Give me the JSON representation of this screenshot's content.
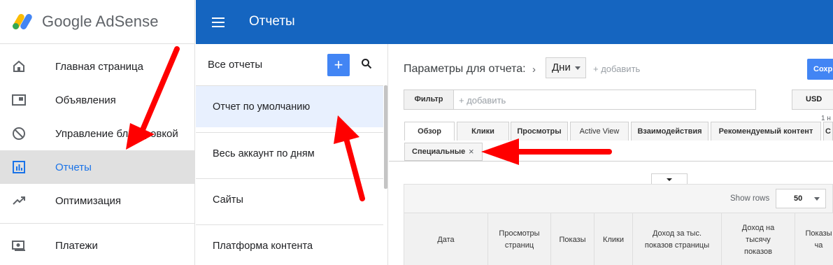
{
  "brand": {
    "name": "Google AdSense"
  },
  "nav": {
    "items": [
      {
        "label": "Главная страница",
        "icon": "home-icon"
      },
      {
        "label": "Объявления",
        "icon": "ads-icon"
      },
      {
        "label": "Управление блокировкой",
        "icon": "block-icon"
      },
      {
        "label": "Отчеты",
        "icon": "reports-icon",
        "active": true
      },
      {
        "label": "Оптимизация",
        "icon": "trending-icon"
      },
      {
        "label": "Платежи",
        "icon": "payments-icon"
      }
    ]
  },
  "topbar": {
    "title": "Отчеты"
  },
  "reports": {
    "header": "Все отчеты",
    "add_label": "+",
    "items": [
      {
        "label": "Отчет по умолчанию",
        "selected": true
      },
      {
        "label": "Весь аккаунт по дням"
      },
      {
        "label": "Сайты"
      },
      {
        "label": "Платформа контента"
      }
    ]
  },
  "main": {
    "params_label": "Параметры для отчета:",
    "chevron": "›",
    "dimension": "Дни",
    "add_dimension": "+ добавить",
    "save_label": "Сохр",
    "filter_label": "Фильтр",
    "filter_add": "+ добавить",
    "currency": "USD",
    "small_text": "1 н",
    "tabs": [
      {
        "label": "Обзор"
      },
      {
        "label": "Клики"
      },
      {
        "label": "Просмотры"
      },
      {
        "label": "Active View"
      },
      {
        "label": "Взаимодействия"
      },
      {
        "label": "Рекомендуемый контент"
      },
      {
        "label": "С"
      }
    ],
    "custom_tab": {
      "label": "Специальные",
      "close": "×"
    },
    "show_rows_label": "Show rows",
    "rows_value": "50",
    "columns": [
      "Дата",
      "Просмотры страниц",
      "Показы",
      "Клики",
      "Доход за тыс. показов страницы",
      "Доход на тысячу показов",
      "Показы ча"
    ]
  },
  "colors": {
    "topbar": "#1565c0",
    "accent": "#4285f4",
    "arrow": "#ff0000",
    "selected_bg": "#e8f0fe"
  }
}
